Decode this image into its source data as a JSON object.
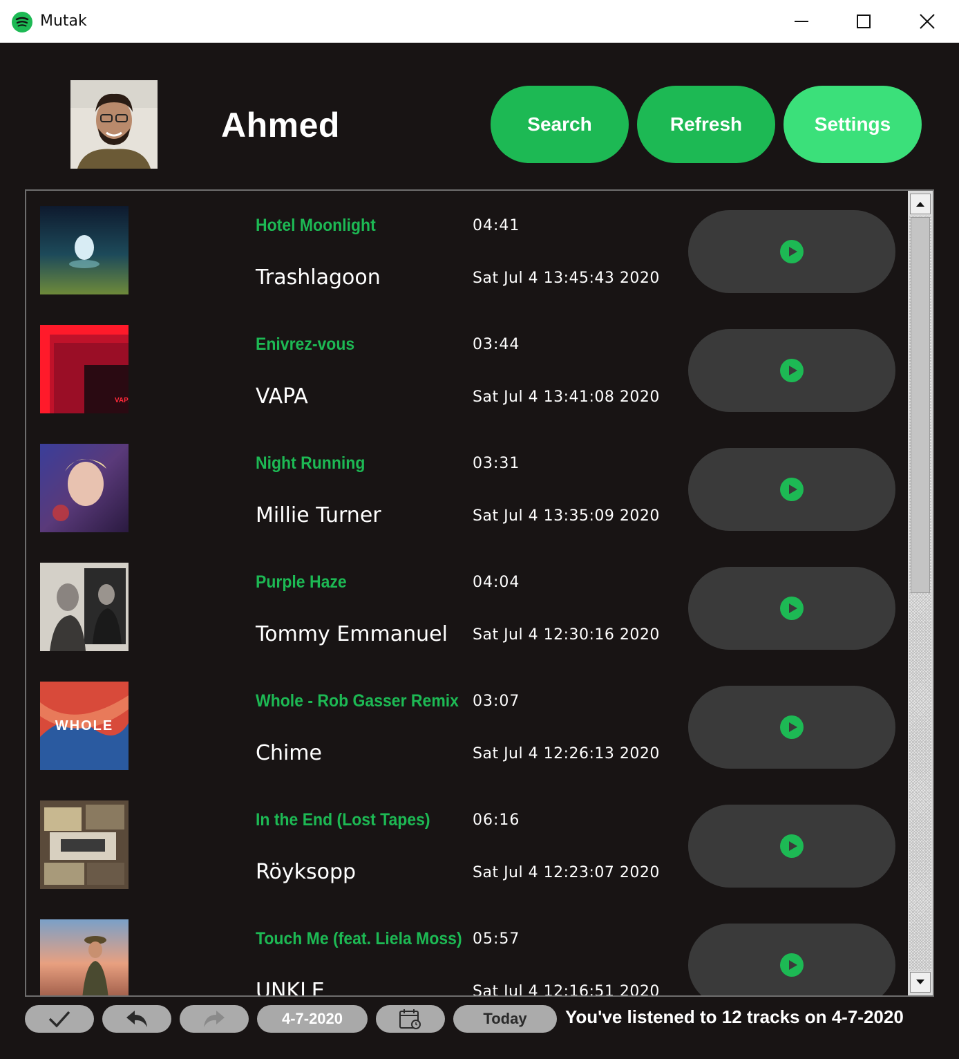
{
  "window": {
    "title": "Mutak",
    "minimize_icon": "minimize-icon",
    "maximize_icon": "maximize-icon",
    "close_icon": "close-icon"
  },
  "header": {
    "username": "Ahmed",
    "buttons": {
      "search": "Search",
      "refresh": "Refresh",
      "settings": "Settings"
    }
  },
  "tracks": [
    {
      "title": "Hotel Moonlight",
      "duration": "04:41",
      "artist": "Trashlagoon",
      "played_at": "Sat Jul 4 13:45:43 2020"
    },
    {
      "title": "Enivrez-vous",
      "duration": "03:44",
      "artist": "VAPA",
      "played_at": "Sat Jul 4 13:41:08 2020"
    },
    {
      "title": "Night Running",
      "duration": "03:31",
      "artist": "Millie Turner",
      "played_at": "Sat Jul 4 13:35:09 2020"
    },
    {
      "title": "Purple Haze",
      "duration": "04:04",
      "artist": "Tommy Emmanuel",
      "played_at": "Sat Jul 4 12:30:16 2020"
    },
    {
      "title": "Whole - Rob Gasser Remix",
      "duration": "03:07",
      "artist": "Chime",
      "played_at": "Sat Jul 4 12:26:13 2020"
    },
    {
      "title": "In the End (Lost Tapes)",
      "duration": "06:16",
      "artist": "Röyksopp",
      "played_at": "Sat Jul 4 12:23:07 2020"
    },
    {
      "title": "Touch Me (feat. Liela Moss)",
      "duration": "05:57",
      "artist": "UNKLE",
      "played_at": "Sat Jul 4 12:16:51 2020"
    }
  ],
  "cover_art_text": {
    "vapa": "VAPA",
    "whole": "WHOLE"
  },
  "footer": {
    "date": "4-7-2020",
    "today": "Today",
    "status": "You've listened to 12 tracks on 4-7-2020",
    "icons": [
      "check-icon",
      "undo-icon",
      "redo-icon",
      "calendar-icon"
    ]
  },
  "colors": {
    "background": "#181414",
    "accent": "#1db954",
    "accent_light": "#3be07a",
    "play_button_bg": "#3a3a3a",
    "footer_button_bg": "#ababab"
  }
}
